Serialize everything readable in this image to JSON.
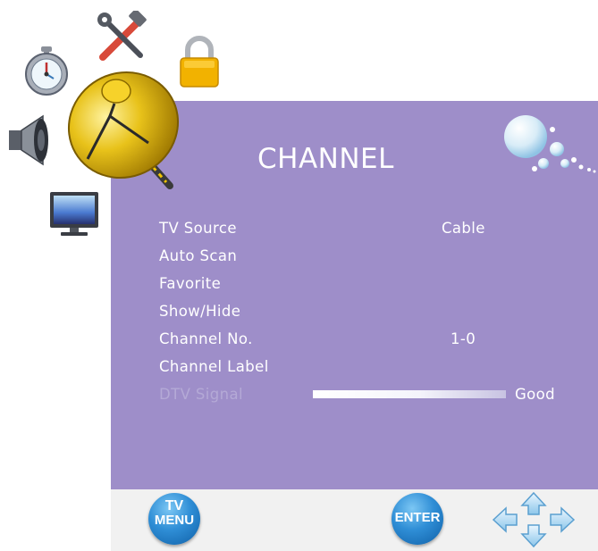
{
  "menu": {
    "title": "CHANNEL",
    "items": [
      {
        "label": "TV Source",
        "value": "Cable"
      },
      {
        "label": "Auto Scan",
        "value": ""
      },
      {
        "label": "Favorite",
        "value": ""
      },
      {
        "label": "Show/Hide",
        "value": ""
      },
      {
        "label": "Channel No.",
        "value": "1-0"
      },
      {
        "label": "Channel Label",
        "value": ""
      },
      {
        "label": "DTV Signal",
        "value": "Good",
        "disabled": true,
        "signal_level": 1.0
      }
    ]
  },
  "footer": {
    "tv_menu_line1": "TV",
    "tv_menu_line2": "MENU",
    "enter_label": "ENTER"
  },
  "icons": {
    "side": [
      "stopwatch-icon",
      "tools-icon",
      "satellite-dish-icon",
      "lock-icon",
      "speaker-icon",
      "monitor-icon",
      "bubbles-decoration",
      "arrow-keys-icon"
    ]
  },
  "colors": {
    "panel": "#9e8ec9",
    "text": "#ffffff",
    "disabled_text": "#b4a9d6",
    "footer_bg": "#f1f1f1",
    "button_blue": "#2f8ed6"
  }
}
